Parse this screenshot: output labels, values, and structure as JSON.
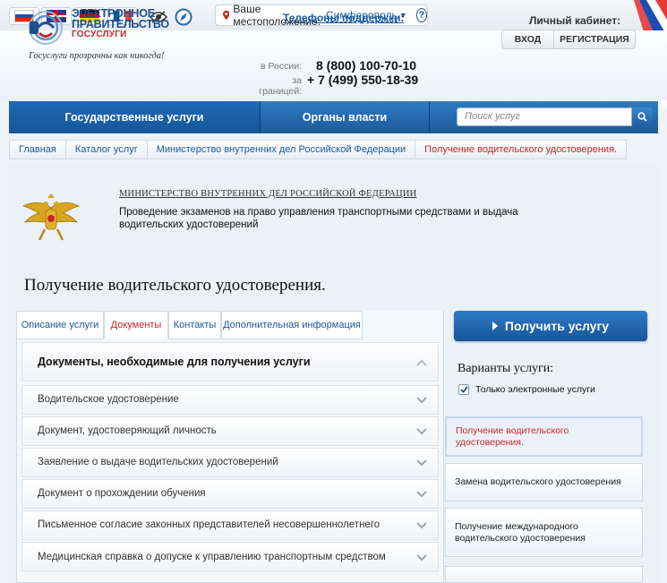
{
  "topbar": {
    "location_label": "Ваше местоположение:",
    "location_city": "Симферополь",
    "help": "?"
  },
  "header": {
    "logo_line1": "ЭЛЕКТРОННОЕ",
    "logo_line2": "ПРАВИТЕЛЬСТВО",
    "logo_line3": "ГОСУСЛУГИ",
    "slogan": "Госуслуги прозрачны как никогда!",
    "support_title": "Телефоны поддержки",
    "phones": [
      {
        "label": "в России:",
        "number": "8 (800) 100-70-10"
      },
      {
        "label": "за границей:",
        "number": "+ 7 (499) 550-18-39"
      }
    ],
    "cabinet_title": "Личный кабинет:",
    "login": "ВХОД",
    "register": "РЕГИСТРАЦИЯ"
  },
  "nav": {
    "items": [
      "Государственные услуги",
      "Органы власти"
    ],
    "search_placeholder": "Поиск услуг"
  },
  "breadcrumbs": [
    "Главная",
    "Каталог услуг",
    "Министерство внутренних дел Российской Федерации",
    "Получение водительского удостоверения."
  ],
  "service": {
    "ministry": "МИНИСТЕРСТВО ВНУТРЕННИХ ДЕЛ РОССИЙСКОЙ ФЕДЕРАЦИИ",
    "description": "Проведение экзаменов на право управления транспортными средствами и выдача водительских удостоверений",
    "title": "Получение водительского удостоверения."
  },
  "tabs": [
    "Описание услуги",
    "Документы",
    "Контакты",
    "Дополнительная информация"
  ],
  "documents": {
    "heading": "Документы, необходимые для получения услуги",
    "rows": [
      "Водительское удостоверение",
      "Документ, удостоверяющий личность",
      "Заявление о выдаче водительских удостоверений",
      "Документ о прохождении обучения",
      "Письменное согласие законных представителей несовершеннолетнего",
      "Медицинская справка о допуске к управлению транспортным средством"
    ]
  },
  "sidebar": {
    "get_service": "Получить услугу",
    "variants_title": "Варианты услуги:",
    "only_electronic": "Только электронные услуги",
    "variants": [
      "Получение водительского удостоверения.",
      "Замена водительского удостоверения",
      "Получение международного водительского удостоверения"
    ]
  },
  "colors": {
    "brand_blue": "#1b5a9a",
    "link_blue": "#1a5aa0",
    "accent_red": "#c62828"
  }
}
